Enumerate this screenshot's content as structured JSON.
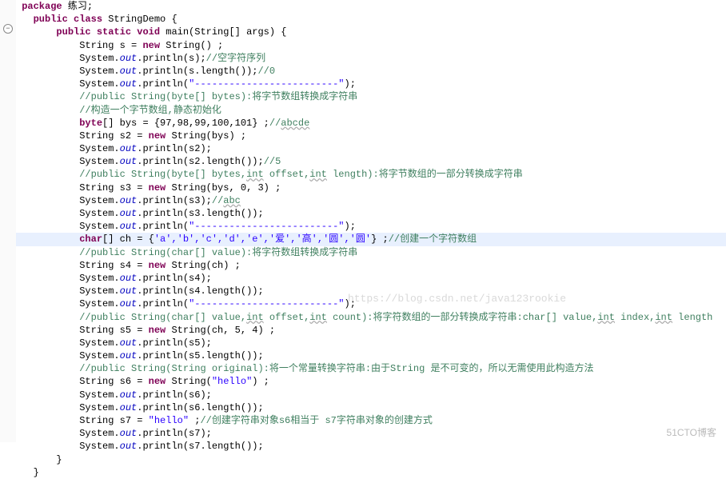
{
  "gutter": {
    "collapse_icon": "−"
  },
  "lines": {
    "l1_pkg": "package",
    "l1_name": " 练习;",
    "l2_mod": "public class",
    "l2_name": " StringDemo {",
    "l3_mod": "public static void",
    "l3_name": " main(String[] args) {",
    "l4a": "String s = ",
    "l4_new": "new",
    "l4b": " String() ;",
    "l5a": "System.",
    "l5_out": "out",
    "l5b": ".println(s);",
    "l5c": "//空字符序列",
    "l6a": "System.",
    "l6b": ".println(s.length());",
    "l6c": "//0",
    "l7a": "System.",
    "l7b": ".println(",
    "l7s": "\"-------------------------\"",
    "l7c": ");",
    "l8": "//public String(byte[] bytes):将字节数组转换成字符串",
    "l9": "//构造一个字节数组,静态初始化",
    "l10_kw": "byte",
    "l10a": "[] bys = {97,98,99,100,101} ;",
    "l10c": "//",
    "l10u": "abcde",
    "l11a": "String s2 = ",
    "l11b": " String(bys) ;",
    "l12a": "System.",
    "l12b": ".println(s2);",
    "l13a": "System.",
    "l13b": ".println(s2.length());",
    "l13c": "//5",
    "l14a": "//public String(byte[] bytes,",
    "l14_int1": "int",
    "l14b": " offset,",
    "l14_int2": "int",
    "l14c": " length):将字节数组的一部分转换成字符串",
    "l15a": "String s3 = ",
    "l15b": " String(bys, 0, 3) ;",
    "l16a": "System.",
    "l16b": ".println(s3);",
    "l16c": "//",
    "l16u": "abc",
    "l17a": "System.",
    "l17b": ".println(s3.length());",
    "l18a": "System.",
    "l18b": ".println(",
    "l18s": "\"-------------------------\"",
    "l18c": ");",
    "l19_kw": "char",
    "l19a": "[] ch = {",
    "l19ch": "'a','b','c','d','e','爱','高','圆','圆'",
    "l19b": "} ;",
    "l19c": "//创建一个字符数组",
    "l20": "//public String(char[] value):将字符数组转换成字符串",
    "l21a": "String s4 = ",
    "l21b": " String(ch) ;",
    "l22a": "System.",
    "l22b": ".println(s4);",
    "l23a": "System.",
    "l23b": ".println(s4.length());",
    "l24a": "System.",
    "l24b": ".println(",
    "l24s": "\"-------------------------\"",
    "l24c": ");",
    "l25a": "//public String(char[] value,",
    "l25_int1": "int",
    "l25b": " offset,",
    "l25_int2": "int",
    "l25c": " count):将字符数组的一部分转换成字符串:char[] value,",
    "l25_int3": "int",
    "l25d": " index,",
    "l25_int4": "int",
    "l25e": " length",
    "l26a": "String s5 = ",
    "l26b": " String(ch, 5, 4) ;",
    "l27a": "System.",
    "l27b": ".println(s5);",
    "l28a": "System.",
    "l28b": ".println(s5.length());",
    "l29a": "//public String(String original):将一个常量转换字符串:由于String 是不可变的，所以无需使用此构造方法",
    "l30a": "String s6 = ",
    "l30b": " String(",
    "l30s": "\"hello\"",
    "l30c": ") ;",
    "l31a": "System.",
    "l31b": ".println(s6);",
    "l32a": "System.",
    "l32b": ".println(s6.length());",
    "l33a": "String s7 = ",
    "l33s": "\"hello\" ",
    "l33b": ";",
    "l33c": "//创建字符串对象s6相当于 s7字符串对象的创建方式",
    "l34a": "System.",
    "l34b": ".println(s7);",
    "l35a": "System.",
    "l35b": ".println(s7.length());",
    "l36": "}",
    "l37": "}"
  },
  "watermark": "https://blog.csdn.net/java123rookie",
  "footer": "51CTO博客"
}
